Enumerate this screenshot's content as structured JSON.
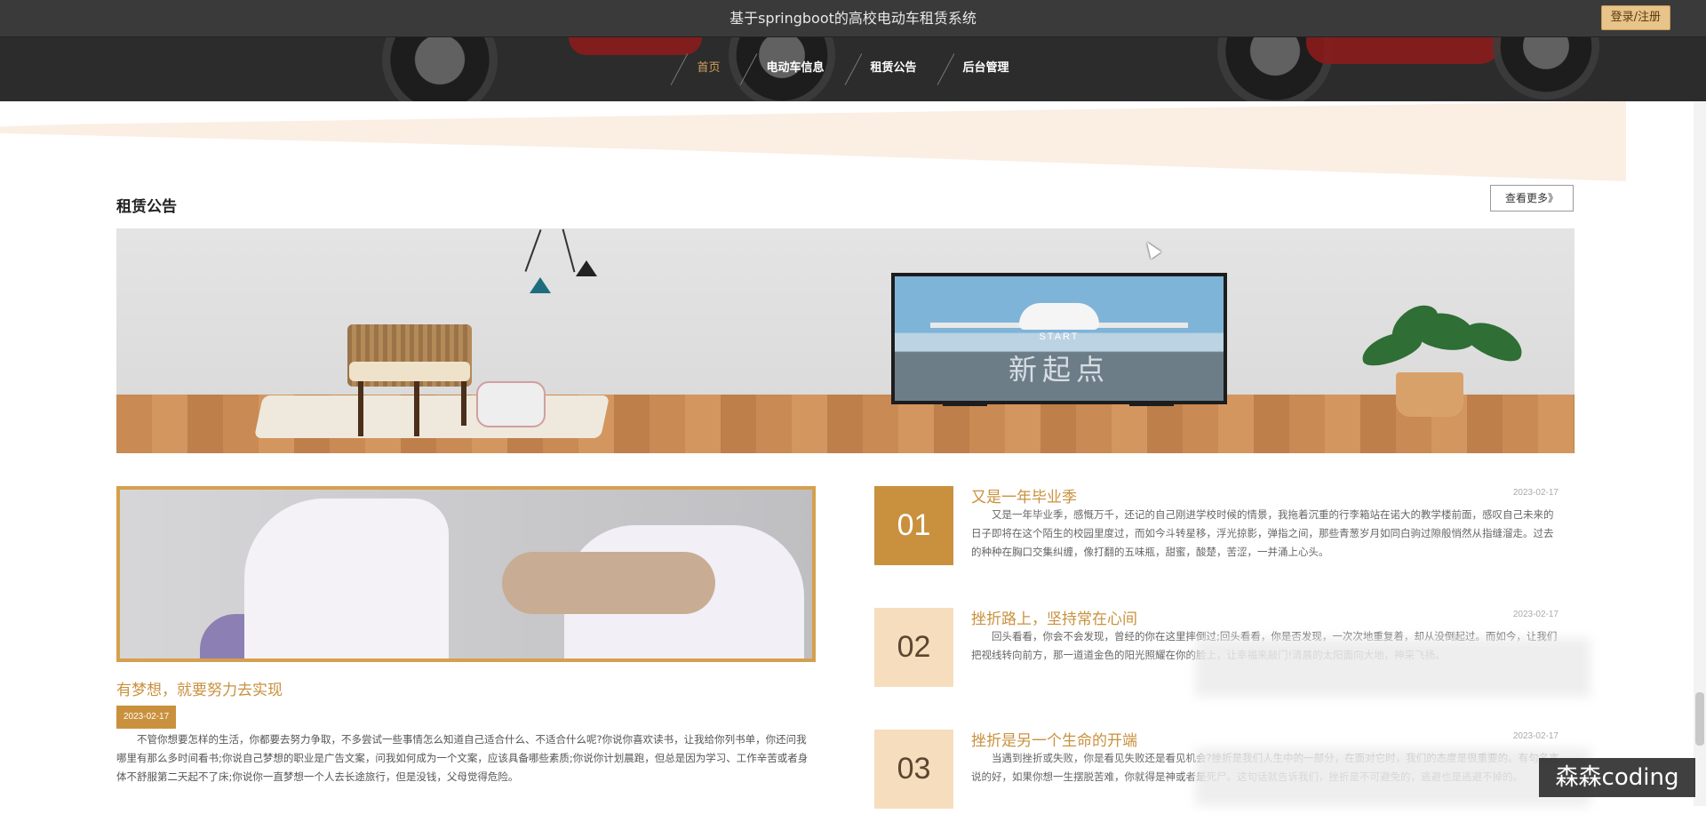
{
  "header": {
    "title": "基于springboot的高校电动车租赁系统",
    "login_label": "登录/注册",
    "nav": [
      {
        "label": "首页",
        "active": true
      },
      {
        "label": "电动车信息",
        "active": false
      },
      {
        "label": "租赁公告",
        "active": false
      },
      {
        "label": "后台管理",
        "active": false
      }
    ]
  },
  "section": {
    "title": "租赁公告",
    "more_label": "查看更多》"
  },
  "banner": {
    "tv_start": "START",
    "tv_caption": "新起点"
  },
  "feature": {
    "title": "有梦想，就要努力去实现",
    "date": "2023-02-17",
    "text": "不管你想要怎样的生活，你都要去努力争取，不多尝试一些事情怎么知道自己适合什么、不适合什么呢?你说你喜欢读书，让我给你列书单，你还问我哪里有那么多时间看书;你说自己梦想的职业是广告文案，问我如何成为一个文案，应该具备哪些素质;你说你计划晨跑，但总是因为学习、工作辛苦或者身体不舒服第二天起不了床;你说你一直梦想一个人去长途旅行，但是没钱，父母觉得危险。"
  },
  "news": [
    {
      "num": "01",
      "title": "又是一年毕业季",
      "date": "2023-02-17",
      "text": "又是一年毕业季，感慨万千，还记的自己刚进学校时候的情景，我拖着沉重的行李箱站在诺大的教学楼前面，感叹自己未来的日子即将在这个陌生的校园里度过，而如今斗转星移，浮光掠影，弹指之间，那些青葱岁月如同白驹过隙般悄然从指缝溜走。过去的种种在胸口交集纠缠，像打翻的五味瓶，甜蜜，酸楚，苦涩，一并涌上心头。"
    },
    {
      "num": "02",
      "title": "挫折路上，坚持常在心间",
      "date": "2023-02-17",
      "text": "回头看看，你会不会发现，曾经的你在这里摔倒过;回头看看，你是否发现，一次次地重复着，却从没倒起过。而如今，让我们把视线转向前方，那一道道金色的阳光照耀在你的脸上，让幸福来敲门!清晨的太阳面向大地，神采飞扬。"
    },
    {
      "num": "03",
      "title": "挫折是另一个生命的开端",
      "date": "2023-02-17",
      "text": "当遇到挫折或失败，你是看见失败还是看见机会?挫折是我们人生中的一部分，在面对它时，我们的态度是很重要的。有句名言说的好，如果你想一生摆脱苦难，你就得是神或者是死尸。这句话就告诉我们，挫折是不可避免的，逃避也是逃避不掉的。"
    }
  ],
  "watermark": "森森coding"
}
